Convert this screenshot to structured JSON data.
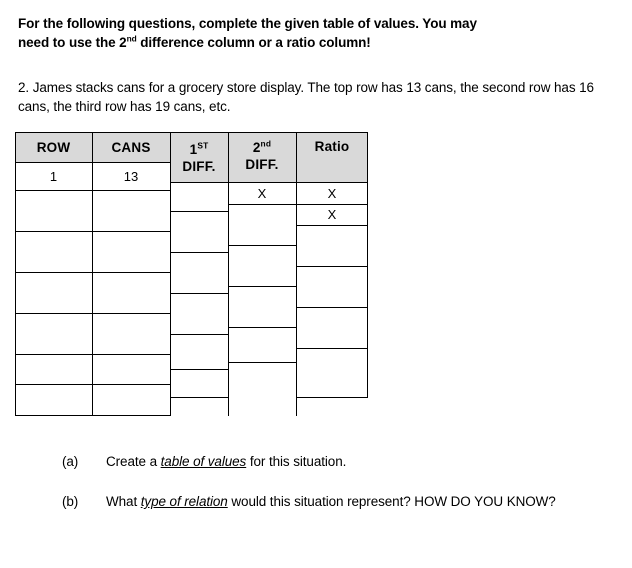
{
  "heading": {
    "line1": "For the following questions, complete the given table of values. You may",
    "line2_pre": "need to use the 2",
    "line2_sup": "nd",
    "line2_post": " difference column or a ratio column!"
  },
  "problem": {
    "text": "2. James stacks cans for a grocery store display.  The top row has 13 cans, the second row has 16 cans, the third row has 19 cans, etc."
  },
  "table": {
    "headers": {
      "row": "ROW",
      "cans": "CANS",
      "first_diff_num": "1",
      "first_diff_sup": "ST",
      "first_diff_word": "DIFF.",
      "second_diff_num": "2",
      "second_diff_sup": "nd",
      "second_diff_word": "DIFF.",
      "ratio": "Ratio"
    },
    "row_column": [
      "1",
      "",
      "",
      "",
      "",
      "",
      ""
    ],
    "cans_column": [
      "13",
      "",
      "",
      "",
      "",
      "",
      ""
    ],
    "first_diff_column": [
      "",
      "",
      "",
      "",
      "",
      "",
      ""
    ],
    "second_diff_column": [
      "X",
      "",
      "",
      "",
      "",
      ""
    ],
    "ratio_column": [
      "X",
      "X",
      "",
      "",
      "",
      "",
      ""
    ],
    "header_fill": "#d9d9d9",
    "border_color": "#000000"
  },
  "questions": {
    "a": {
      "label": "(a)",
      "pre": "Create a ",
      "emph": "table of values",
      "post": " for this situation."
    },
    "b": {
      "label": "(b)",
      "pre": "What ",
      "emph": "type of relation",
      "post": " would this situation represent?  HOW DO YOU KNOW?"
    }
  }
}
